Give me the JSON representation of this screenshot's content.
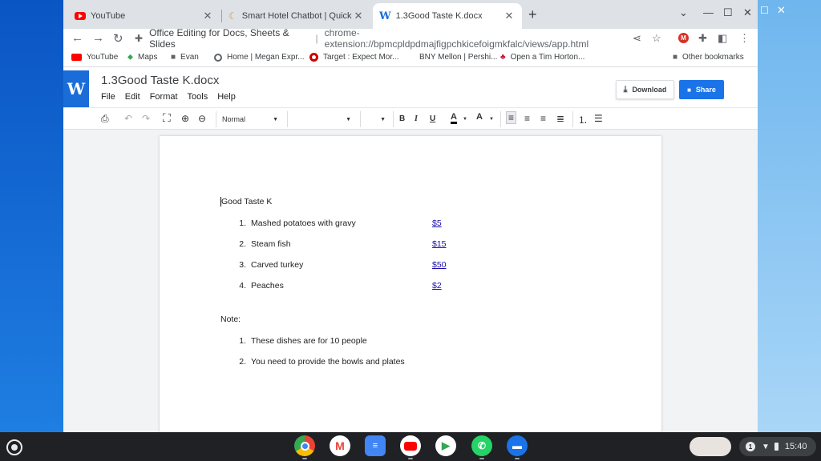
{
  "browser": {
    "tabs": [
      {
        "title": "YouTube",
        "icon": "youtube-icon"
      },
      {
        "title": "Smart Hotel Chatbot | Quick Res",
        "icon": "chatbot-icon"
      },
      {
        "title": "1.3Good Taste K.docx",
        "icon": "word-icon"
      }
    ],
    "omnibox": {
      "chip": "Office Editing for Docs, Sheets & Slides",
      "url": "chrome-extension://bpmcpldpdmajfigpchkicefoigmkfalc/views/app.html"
    },
    "bookmarks": [
      {
        "label": "YouTube",
        "icon": "youtube-icon"
      },
      {
        "label": "Maps",
        "icon": "maps-icon"
      },
      {
        "label": "Evan",
        "icon": "folder-icon"
      },
      {
        "label": "Home | Megan Expr...",
        "icon": "circle-icon"
      },
      {
        "label": "Target : Expect Mor...",
        "icon": "target-icon"
      },
      {
        "label": "BNY Mellon | Pershi...",
        "icon": ""
      },
      {
        "label": "Open a Tim Horton...",
        "icon": "maple-leaf-icon"
      }
    ],
    "other_bookmarks": "Other bookmarks"
  },
  "app": {
    "logo": "W",
    "doc_title": "1.3Good Taste K.docx",
    "menu": [
      "File",
      "Edit",
      "Format",
      "Tools",
      "Help"
    ],
    "download_label": "Download",
    "share_label": "Share",
    "style_select": "Normal",
    "font_select": "",
    "size_select": ""
  },
  "document": {
    "heading": "Good Taste K",
    "items": [
      {
        "num": "1.",
        "text": "Mashed potatoes with gravy",
        "price": "$5"
      },
      {
        "num": "2.",
        "text": "Steam fish",
        "price": "$15"
      },
      {
        "num": "3.",
        "text": "Carved turkey",
        "price": "$50"
      },
      {
        "num": "4.",
        "text": "Peaches",
        "price": "$2"
      }
    ],
    "note_label": "Note:",
    "notes": [
      {
        "num": "1.",
        "text": "These dishes are for 10 people"
      },
      {
        "num": "2.",
        "text": "You need to provide the bowls and plates"
      }
    ]
  },
  "shelf": {
    "time": "15:40",
    "notification_count": "1"
  },
  "colors": {
    "accent": "#1a73e8",
    "word_blue": "#1a6dd9",
    "link": "#1a0dab"
  }
}
